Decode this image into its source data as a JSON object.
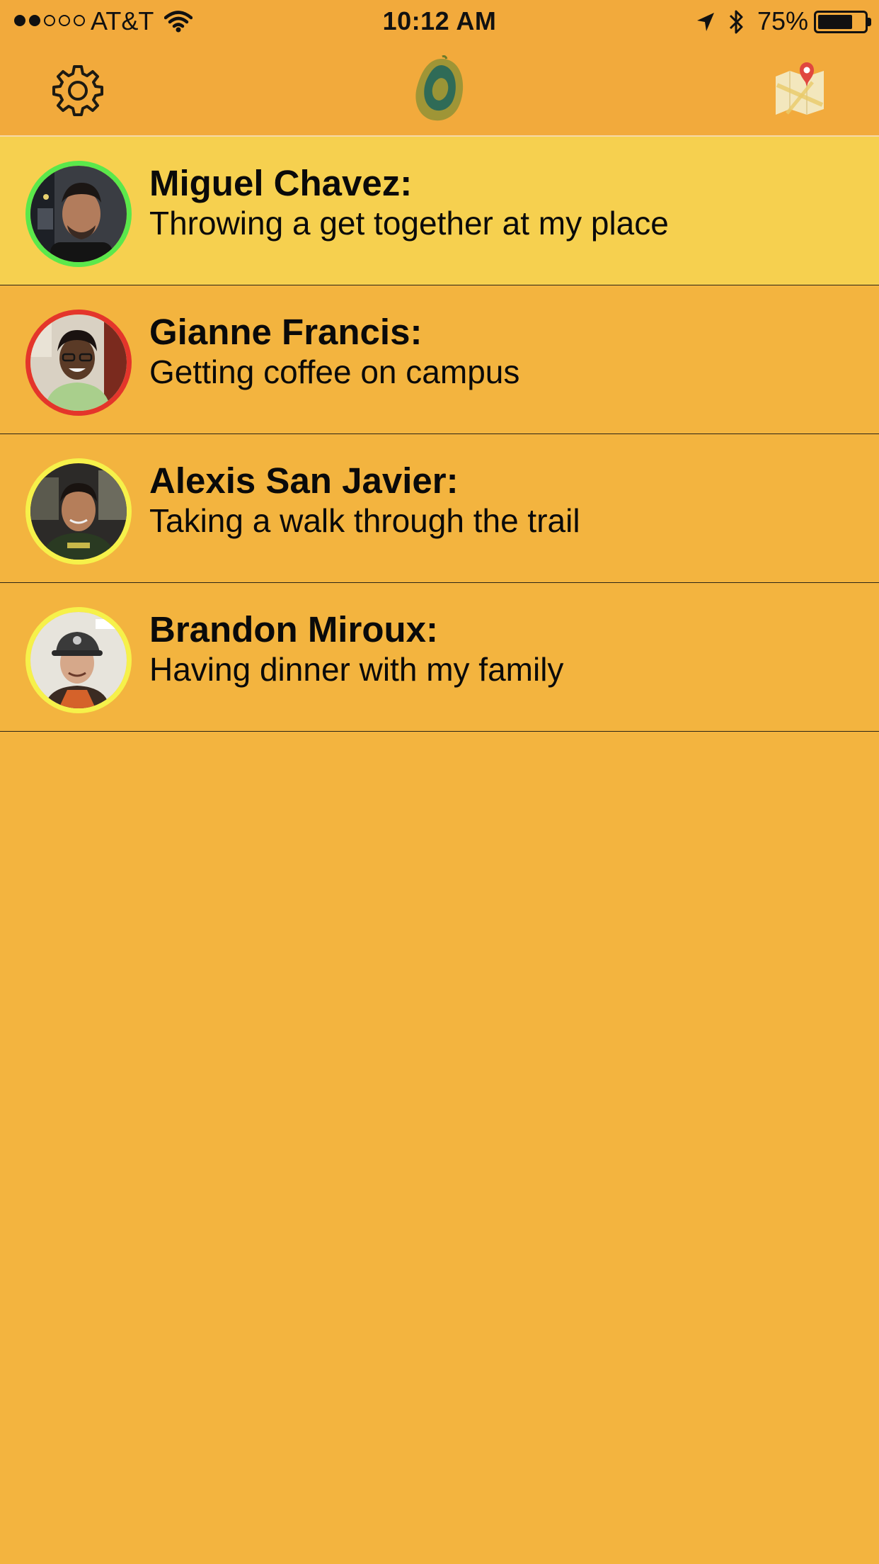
{
  "status_bar": {
    "signal_bars": 5,
    "signal_filled": 2,
    "carrier": "AT&T",
    "time": "10:12 AM",
    "battery_percent": "75%",
    "battery_level": 0.75,
    "icons": [
      "wifi-icon",
      "location-arrow-icon",
      "bluetooth-icon",
      "battery-icon"
    ]
  },
  "nav": {
    "left_icon": "gear-icon",
    "center_icon": "avocado-logo-icon",
    "right_icon": "map-pin-icon"
  },
  "colors": {
    "background": "#F3B43F",
    "header": "#F2AA3C",
    "highlight_row": "#F6D04F",
    "ring_green": "#5BE84B",
    "ring_red": "#E4352B",
    "ring_yellow": "#F6F14A"
  },
  "feed": {
    "items": [
      {
        "name": "Miguel Chavez:",
        "status": "Throwing a get together at my place",
        "ring_color": "#5BE84B",
        "highlighted": true
      },
      {
        "name": "Gianne Francis:",
        "status": "Getting coffee on campus",
        "ring_color": "#E4352B",
        "highlighted": false
      },
      {
        "name": "Alexis San Javier:",
        "status": "Taking a walk through the trail",
        "ring_color": "#F6F14A",
        "highlighted": false
      },
      {
        "name": "Brandon Miroux:",
        "status": "Having dinner with my family",
        "ring_color": "#F6F14A",
        "highlighted": false
      }
    ]
  }
}
